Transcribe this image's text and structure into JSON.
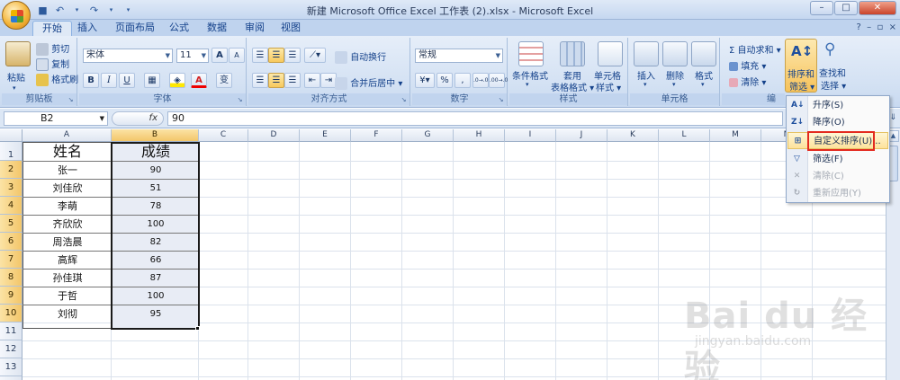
{
  "window": {
    "title": "新建 Microsoft Office Excel 工作表 (2).xlsx - Microsoft Excel",
    "controls": [
      "–",
      "□",
      "✕"
    ]
  },
  "tabs": [
    "开始",
    "插入",
    "页面布局",
    "公式",
    "数据",
    "审阅",
    "视图"
  ],
  "ribbon": {
    "clipboard": {
      "label": "剪贴板",
      "paste": "粘贴",
      "cut": "剪切",
      "copy": "复制",
      "format_painter": "格式刷"
    },
    "font": {
      "label": "字体",
      "font_name": "宋体",
      "font_size": "11",
      "bold": "B",
      "italic": "I",
      "underline": "U",
      "grow": "A",
      "shrink": "A",
      "color_a": "A",
      "wen": "变"
    },
    "alignment": {
      "label": "对齐方式",
      "wrap": "自动换行",
      "merge": "合并后居中"
    },
    "number": {
      "label": "数字",
      "format": "常规",
      "percent": "%",
      "comma": ",",
      "inc_dec": ".0→.00",
      "dec_dec": ".00→.0"
    },
    "styles": {
      "label": "样式",
      "conditional": "条件格式",
      "table_format_1": "套用",
      "table_format_2": "表格格式",
      "cell_style_1": "单元格",
      "cell_style_2": "样式"
    },
    "cells": {
      "label": "单元格",
      "insert": "插入",
      "delete": "删除",
      "format": "格式"
    },
    "editing": {
      "label": "编",
      "autosum": "Σ 自动求和",
      "fill": "填充",
      "clear": "清除",
      "sort_1": "排序和",
      "sort_2": "筛选",
      "find_1": "查找和",
      "find_2": "选择"
    }
  },
  "formula_bar": {
    "name_box": "B2",
    "fx": "fx",
    "content": "90"
  },
  "columns": [
    "A",
    "B",
    "C",
    "D",
    "E",
    "F",
    "G",
    "H",
    "I",
    "J",
    "K",
    "L",
    "M",
    "N"
  ],
  "rows": [
    "1",
    "2",
    "3",
    "4",
    "5",
    "6",
    "7",
    "8",
    "9",
    "10",
    "11",
    "12",
    "13",
    "14"
  ],
  "table": {
    "headers": [
      "姓名",
      "成绩"
    ],
    "names": [
      "张一",
      "刘佳欣",
      "李萌",
      "齐欣欣",
      "周浩晨",
      "高辉",
      "孙佳琪",
      "于哲",
      "刘彻"
    ],
    "scores": [
      "90",
      "51",
      "78",
      "100",
      "82",
      "66",
      "87",
      "100",
      "95"
    ]
  },
  "sort_menu": {
    "items": [
      "升序(S)",
      "降序(O)",
      "自定义排序(U)...",
      "筛选(F)",
      "清除(C)",
      "重新应用(Y)"
    ],
    "icons": [
      "A↓",
      "Z↓",
      "⊞",
      "▽",
      "✕",
      "↻"
    ]
  },
  "watermark": {
    "logo": "Bai du 经验",
    "sub": "jingyan.baidu.com"
  }
}
